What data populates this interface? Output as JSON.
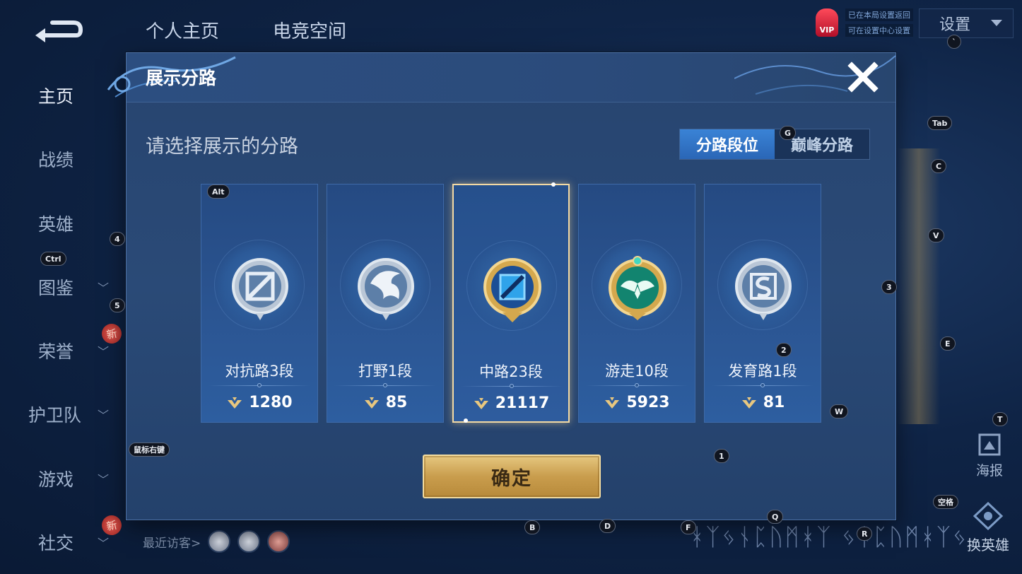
{
  "top_tabs": [
    "个人主页",
    "电竞空间"
  ],
  "settings": {
    "label": "设置"
  },
  "vip": {
    "badge": "VIP",
    "line1": "已在本局设置返回",
    "line2": "可在设置中心设置"
  },
  "sidebar": {
    "items": [
      {
        "label": "主页",
        "chevron": false,
        "new": false
      },
      {
        "label": "战绩",
        "chevron": false,
        "new": false
      },
      {
        "label": "英雄",
        "chevron": false,
        "new": false
      },
      {
        "label": "图鉴",
        "chevron": true,
        "new": false
      },
      {
        "label": "荣誉",
        "chevron": true,
        "new": true
      },
      {
        "label": "护卫队",
        "chevron": true,
        "new": false
      },
      {
        "label": "游戏",
        "chevron": true,
        "new": false
      },
      {
        "label": "社交",
        "chevron": true,
        "new": true
      }
    ],
    "new_badge": "新"
  },
  "visitors": {
    "label": "最近访客>"
  },
  "poster": {
    "label": "海报"
  },
  "swap_hero": {
    "label": "换英雄"
  },
  "modal": {
    "title": "展示分路",
    "subtitle": "请选择展示的分路",
    "segments": [
      {
        "label": "分路段位",
        "active": true
      },
      {
        "label": "巅峰分路",
        "active": false
      }
    ],
    "cards": [
      {
        "name": "对抗路3段",
        "score": "1280",
        "selected": false,
        "emblem": "clash-lane-emblem"
      },
      {
        "name": "打野1段",
        "score": "85",
        "selected": false,
        "emblem": "jungle-emblem"
      },
      {
        "name": "中路23段",
        "score": "21117",
        "selected": true,
        "emblem": "mid-lane-emblem"
      },
      {
        "name": "游走10段",
        "score": "5923",
        "selected": false,
        "emblem": "roam-emblem"
      },
      {
        "name": "发育路1段",
        "score": "81",
        "selected": false,
        "emblem": "farm-lane-emblem"
      }
    ],
    "confirm": {
      "label": "确定"
    }
  },
  "key_hints": [
    "Alt",
    "Ctrl",
    "4",
    "5",
    "鼠标右键",
    "G",
    "Tab",
    "C",
    "V",
    "3",
    "2",
    "E",
    "W",
    "T",
    "1",
    "空格",
    "Q",
    "B",
    "D",
    "F",
    "R",
    "`"
  ],
  "colors": {
    "accent_blue": "#3a83d6",
    "gold": "#e6c77f",
    "panel": "#2a4a77"
  }
}
